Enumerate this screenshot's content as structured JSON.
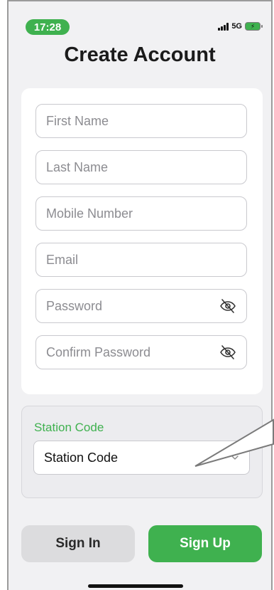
{
  "status_bar": {
    "time": "17:28",
    "network": "5G"
  },
  "page_title": "Create Account",
  "form": {
    "first_name_placeholder": "First Name",
    "last_name_placeholder": "Last Name",
    "mobile_placeholder": "Mobile Number",
    "email_placeholder": "Email",
    "password_placeholder": "Password",
    "confirm_password_placeholder": "Confirm Password"
  },
  "station": {
    "label": "Station Code",
    "selected": "Station Code"
  },
  "buttons": {
    "sign_in": "Sign In",
    "sign_up": "Sign Up"
  },
  "colors": {
    "accent": "#3fb14f",
    "secondary_button": "#dcdcde",
    "background": "#f1f1f3"
  },
  "icons": {
    "password_toggle": "eye-slash-icon",
    "select_arrow": "chevron-down-icon",
    "signal": "signal-bars-icon",
    "battery": "battery-charging-icon"
  }
}
